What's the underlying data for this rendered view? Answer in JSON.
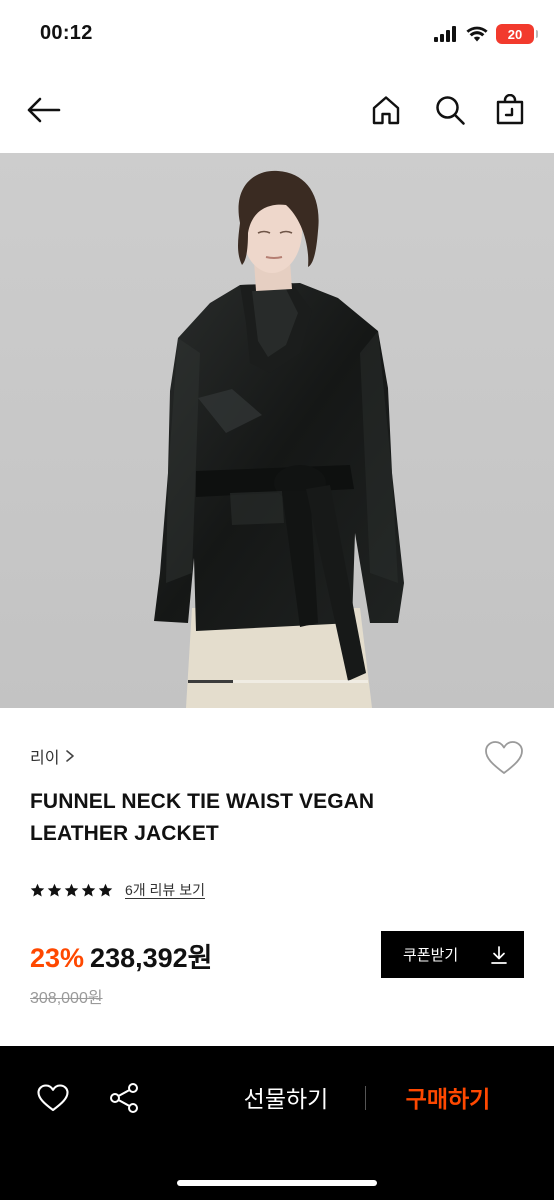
{
  "status": {
    "time": "00:12",
    "battery": "20"
  },
  "product": {
    "brand": "리이",
    "title": "FUNNEL NECK TIE WAIST VEGAN LEATHER JACKET",
    "rating_stars": 5,
    "review_link": "6개 리뷰 보기",
    "discount": "23%",
    "price": "238,392원",
    "original_price": "308,000원",
    "image_index": 1,
    "image_count": 4
  },
  "coupon": {
    "label": "쿠폰받기"
  },
  "bottom_bar": {
    "gift_label": "선물하기",
    "buy_label": "구매하기"
  },
  "colors": {
    "accent": "#ff4800",
    "bar": "#000000",
    "battery": "#f23a2d"
  }
}
